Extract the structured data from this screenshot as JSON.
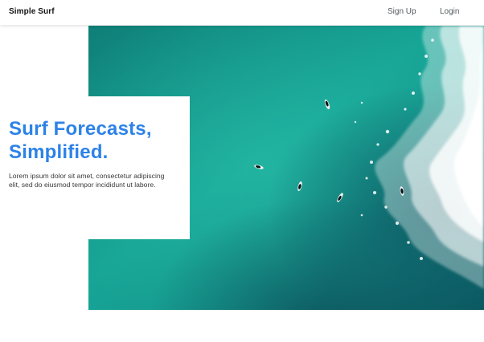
{
  "header": {
    "brand": "Simple Surf",
    "nav": {
      "signup": "Sign Up",
      "login": "Login"
    }
  },
  "hero": {
    "title_line1": "Surf Forecasts,",
    "title_line2": "Simplified.",
    "body": "Lorem ipsum dolor sit amet, consectetur adipiscing elit, sed do eiusmod tempor incididunt ut labore.",
    "image_subject": "aerial view of surfers in turquoise ocean water with breaking white waves"
  },
  "colors": {
    "accent": "#2d82e8",
    "text": "#3a3a3a",
    "nav": "#555b60",
    "ocean": "#17a596",
    "ocean_deep": "#0c4c5a"
  }
}
